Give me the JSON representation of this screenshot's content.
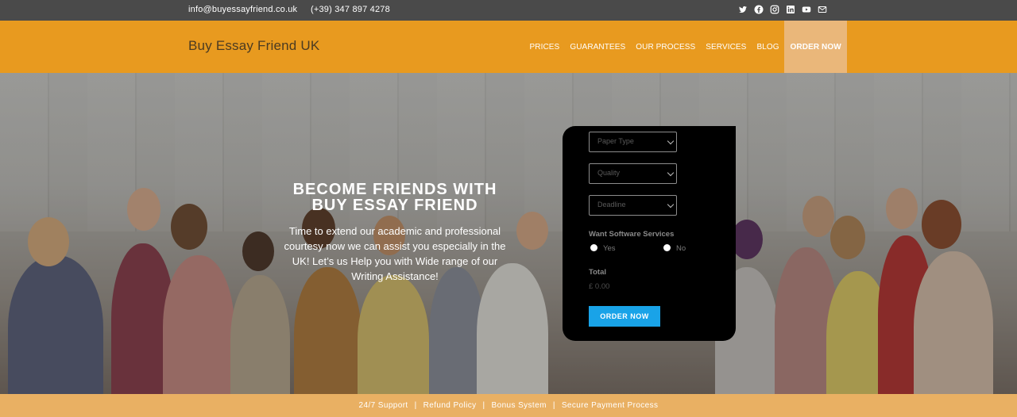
{
  "topbar": {
    "email": "info@buyessayfriend.co.uk",
    "phone": "(+39) 347 897 4278",
    "social_icons": [
      "twitter-icon",
      "facebook-icon",
      "instagram-icon",
      "linkedin-icon",
      "youtube-icon",
      "mail-icon"
    ]
  },
  "header": {
    "brand": "Buy Essay Friend UK",
    "nav": {
      "prices": "PRICES",
      "guarantees": "GUARANTEES",
      "process": "OUR PROCESS",
      "services": "SERVICES",
      "blog": "BLOG",
      "order": "ORDER NOW"
    }
  },
  "hero": {
    "title_line1": "BECOME FRIENDS WITH",
    "title_line2": "BUY ESSAY FRIEND",
    "text": "Time to extend our academic and professional courtesy now we can assist you especially in the UK! Let’s us Help you with Wide range of our Writing Assistance!"
  },
  "form": {
    "paper_type": "Paper Type",
    "quality": "Quality",
    "deadline": "Deadline",
    "software_label": "Want Software Services",
    "yes": "Yes",
    "no": "No",
    "total_label": "Total",
    "total_value": "£ 0.00",
    "button": "ORDER NOW"
  },
  "footer": {
    "support": "24/7 Support",
    "refund": "Refund Policy",
    "bonus": "Bonus System",
    "payment": "Secure Payment Process",
    "separator": "|"
  },
  "colors": {
    "topbar": "#4a4a4a",
    "header": "#e89a1f",
    "order_nav": "#eab77a",
    "form_bg": "#000000",
    "order_button": "#19a3e8",
    "footer": "#e9b063"
  }
}
